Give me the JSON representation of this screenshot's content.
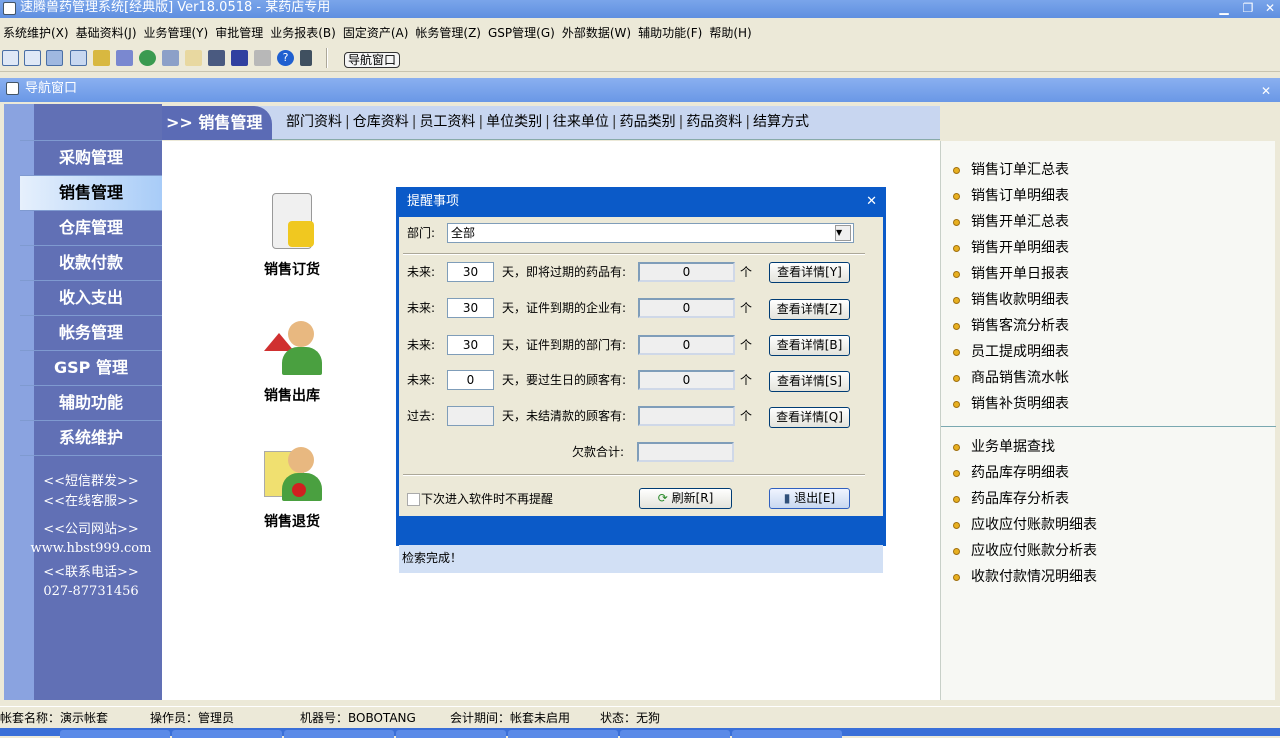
{
  "app": {
    "title": "速腾兽药管理系统[经典版] Ver18.0518  -  某药店专用"
  },
  "menu": [
    "系统维护(X)",
    "基础资料(J)",
    "业务管理(Y)",
    "审批管理",
    "业务报表(B)",
    "固定资产(A)",
    "帐务管理(Z)",
    "GSP管理(G)",
    "外部数据(W)",
    "辅助功能(F)",
    "帮助(H)"
  ],
  "toolbar": {
    "nav_button": "导航窗口",
    "icons": [
      "grid-icon",
      "list-icon",
      "windows-icon",
      "search-doc-icon",
      "coins-icon",
      "wizard-icon",
      "users-icon",
      "forms-icon",
      "notes-icon",
      "calculator-icon",
      "save-icon",
      "print-icon",
      "help-icon",
      "exit-icon"
    ]
  },
  "nav_window": {
    "title": "导航窗口"
  },
  "sidebar": {
    "items": [
      "采购管理",
      "销售管理",
      "仓库管理",
      "收款付款",
      "收入支出",
      "帐务管理",
      "GSP 管理",
      "辅助功能",
      "系统维护"
    ],
    "active": 1,
    "links": [
      "<<短信群发>>",
      "<<在线客服>>",
      "<<公司网站>>",
      "www.hbst999.com",
      "<<联系电话>>",
      "027-87731456"
    ]
  },
  "tabbar": {
    "current": ">> 销售管理",
    "tabs": [
      "部门资料",
      "仓库资料",
      "员工资料",
      "单位类别",
      "往来单位",
      "药品类别",
      "药品资料",
      "结算方式"
    ]
  },
  "functions": [
    "销售订货",
    "销售出库",
    "销售退货"
  ],
  "reports": {
    "group1": [
      "销售订单汇总表",
      "销售订单明细表",
      "销售开单汇总表",
      "销售开单明细表",
      "销售开单日报表",
      "销售收款明细表",
      "销售客流分析表",
      "员工提成明细表",
      "商品销售流水帐",
      "销售补货明细表"
    ],
    "group2": [
      "业务单据查找",
      "药品库存明细表",
      "药品库存分析表",
      "应收应付账款明细表",
      "应收应付账款分析表",
      "收款付款情况明细表"
    ]
  },
  "dialog": {
    "title": "提醒事项",
    "dept_label": "部门:",
    "dept_value": "全部",
    "rows": [
      {
        "label": "未来:",
        "days": "30",
        "desc": "天，即将过期的药品有:",
        "count": "0",
        "unit": "个",
        "button": "查看详情[Y]"
      },
      {
        "label": "未来:",
        "days": "30",
        "desc": "天，证件到期的企业有:",
        "count": "0",
        "unit": "个",
        "button": "查看详情[Z]"
      },
      {
        "label": "未来:",
        "days": "30",
        "desc": "天，证件到期的部门有:",
        "count": "0",
        "unit": "个",
        "button": "查看详情[B]"
      },
      {
        "label": "未来:",
        "days": "0",
        "desc": "天，要过生日的顾客有:",
        "count": "0",
        "unit": "个",
        "button": "查看详情[S]"
      },
      {
        "label": "过去:",
        "days": "",
        "desc": "天，未结清款的顾客有:",
        "count": "",
        "unit": "个",
        "button": "查看详情[Q]"
      }
    ],
    "debt_label": "欠款合计:",
    "debt_value": "",
    "no_remind": "下次进入软件时不再提醒",
    "refresh": "刷新[R]",
    "exit": "退出[E]",
    "status": "检索完成！"
  },
  "statusbar": {
    "account": "帐套名称：演示帐套",
    "operator": "操作员：管理员",
    "machine": "机器号：BOBOTANG",
    "period": "会计期间：帐套未启用",
    "state": "状态：无狗"
  }
}
